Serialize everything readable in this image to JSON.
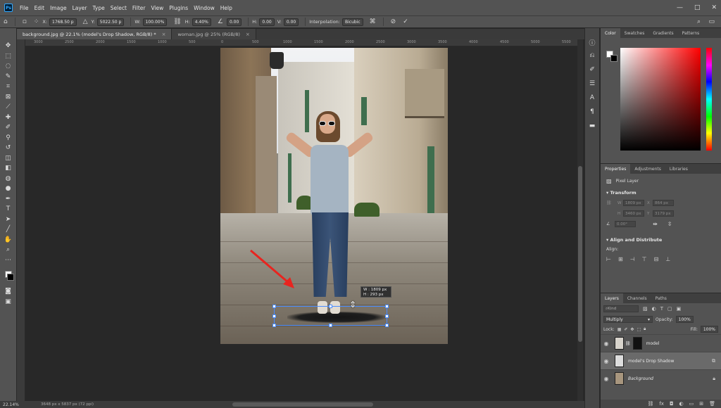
{
  "app": {
    "logo": "Ps",
    "menu": [
      "File",
      "Edit",
      "Image",
      "Layer",
      "Type",
      "Select",
      "Filter",
      "View",
      "Plugins",
      "Window",
      "Help"
    ],
    "window_controls": {
      "minimize": "—",
      "maximize": "□",
      "close": "✕"
    }
  },
  "options": {
    "x_label": "X:",
    "x_value": "1768.50 p",
    "y_label": "Y:",
    "y_value": "5022.50 p",
    "w_label": "W:",
    "w_value": "100.00%",
    "h_label": "H:",
    "h_value": "4.40%",
    "angle_value": "0.00",
    "hskew_label": "H:",
    "hskew_value": "0.00",
    "vskew_label": "V:",
    "vskew_value": "0.00",
    "interp_label": "Interpolation:",
    "interp_value": "Bicubic"
  },
  "tabs": [
    {
      "label": "background.jpg @ 22.1% (model's Drop Shadow, RGB/8) *",
      "close": "×"
    },
    {
      "label": "woman.jpg @ 25% (RGB/8)",
      "close": "×"
    }
  ],
  "ruler": {
    "top": [
      "3000",
      "2500",
      "2000",
      "1500",
      "1000",
      "500",
      "0",
      "500",
      "1000",
      "1500",
      "2000",
      "2500",
      "3000",
      "3500",
      "4000",
      "4500",
      "5000",
      "5500"
    ]
  },
  "canvas": {
    "transform_tooltip": {
      "w": "W :  1809 px",
      "h": "H :    293 px"
    }
  },
  "status": {
    "zoom": "22.14%",
    "doc_info": "3648 px x 5837 px (72 ppi)"
  },
  "panels": {
    "color_tabs": [
      "Color",
      "Swatches",
      "Gradients",
      "Patterns"
    ],
    "properties_tabs": [
      "Properties",
      "Adjustments",
      "Libraries"
    ],
    "properties": {
      "layer_type": "Pixel Layer",
      "transform_title": "Transform",
      "w_label": "W",
      "w_value": "1809 px",
      "x_label": "X",
      "x_value": "864 px",
      "h_label": "H",
      "h_value": "3460 px",
      "y_label": "Y",
      "y_value": "3179 px",
      "angle_value": "0.00°",
      "align_title": "Align and Distribute",
      "align_label": "Align:"
    },
    "layers_tabs": [
      "Layers",
      "Channels",
      "Paths"
    ],
    "layers": {
      "kind_placeholder": "Kind",
      "blend_mode": "Multiply",
      "opacity_label": "Opacity:",
      "opacity_value": "100%",
      "lock_label": "Lock:",
      "fill_label": "Fill:",
      "fill_value": "100%",
      "items": [
        {
          "name": "model",
          "visible": true
        },
        {
          "name": "model's Drop Shadow",
          "visible": true,
          "selected": true
        },
        {
          "name": "Background",
          "visible": true,
          "locked": true
        }
      ]
    }
  }
}
